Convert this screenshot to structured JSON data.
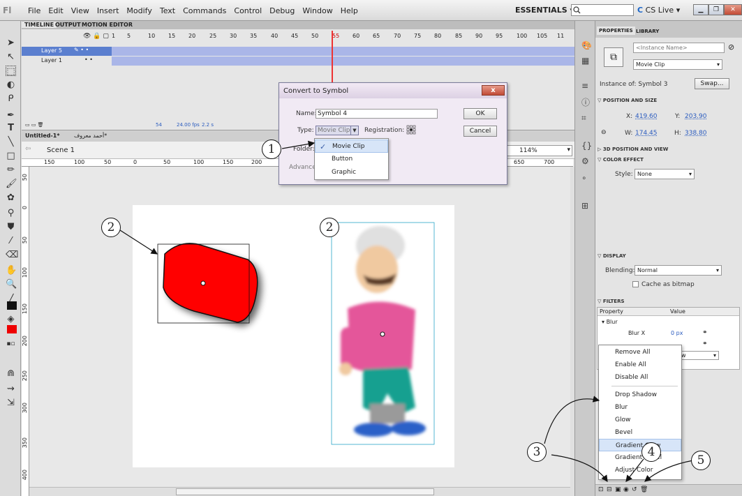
{
  "app": {
    "logo": "Fl",
    "workspace": "ESSENTIALS ▾",
    "cslive": "CS Live"
  },
  "menu": [
    "File",
    "Edit",
    "View",
    "Insert",
    "Modify",
    "Text",
    "Commands",
    "Control",
    "Debug",
    "Window",
    "Help"
  ],
  "timeline": {
    "tabs": [
      "TIMELINE",
      "OUTPUT",
      "MOTION EDITOR"
    ],
    "frame_numbers": [
      "1",
      "5",
      "10",
      "15",
      "20",
      "25",
      "30",
      "35",
      "40",
      "45",
      "50",
      "55",
      "60",
      "65",
      "70",
      "75",
      "80",
      "85",
      "90",
      "95",
      "100",
      "105",
      "11"
    ],
    "layers": [
      {
        "name": "Layer 5"
      },
      {
        "name": "Layer 1"
      }
    ],
    "footer": {
      "frame": "54",
      "fps": "24.00 fps",
      "time": "2.2 s"
    }
  },
  "documents": {
    "tabs": [
      "Untitled-1*",
      "أحمد معروف*"
    ],
    "scene": "Scene 1",
    "zoom": "114%"
  },
  "rulers": {
    "h": [
      "150",
      "100",
      "50",
      "0",
      "50",
      "100",
      "150",
      "200",
      "650",
      "700"
    ],
    "v": [
      "50",
      "0",
      "50",
      "100",
      "150",
      "200",
      "250",
      "300",
      "350",
      "400"
    ]
  },
  "dialog": {
    "title": "Convert to Symbol",
    "name_label": "Name:",
    "name_value": "Symbol 4",
    "type_label": "Type:",
    "type_value": "Movie Clip",
    "registration_label": "Registration:",
    "folder_label": "Folder:",
    "advanced_label": "Advanced",
    "ok": "OK",
    "cancel": "Cancel",
    "close": "x",
    "type_options": [
      {
        "label": "Movie Clip",
        "checked": true
      },
      {
        "label": "Button",
        "checked": false
      },
      {
        "label": "Graphic",
        "checked": false
      }
    ]
  },
  "properties": {
    "tabs": [
      "PROPERTIES",
      "LIBRARY"
    ],
    "instance_name_placeholder": "<Instance Name>",
    "symbol_type": "Movie Clip",
    "instance_of": "Instance of: Symbol 3",
    "swap": "Swap...",
    "position_section": "POSITION AND SIZE",
    "x_label": "X:",
    "x_value": "419.60",
    "y_label": "Y:",
    "y_value": "203.90",
    "w_label": "W:",
    "w_value": "174.45",
    "h_label": "H:",
    "h_value": "338.80",
    "threed_section": "3D POSITION AND VIEW",
    "color_section": "COLOR EFFECT",
    "style_label": "Style:",
    "style_value": "None",
    "display_section": "DISPLAY",
    "blending_label": "Blending:",
    "blending_value": "Normal",
    "cache_label": "Cache as bitmap",
    "filters_section": "FILTERS",
    "filter_headers": [
      "Property",
      "Value"
    ],
    "filter_name": "Blur",
    "blur_x_label": "Blur X",
    "blur_x_value": "0 px",
    "quality_value": "w"
  },
  "context_menu": [
    "Remove All",
    "Enable All",
    "Disable All",
    "Drop Shadow",
    "Blur",
    "Glow",
    "Bevel",
    "Gradient Glow",
    "Gradient Bevel",
    "Adjust Color"
  ],
  "callouts": [
    "1",
    "2",
    "2",
    "3",
    "4",
    "5"
  ],
  "colors": {
    "accent": "#5b7fcf",
    "shape_fill": "#ff0000",
    "playhead": "#e33333"
  }
}
